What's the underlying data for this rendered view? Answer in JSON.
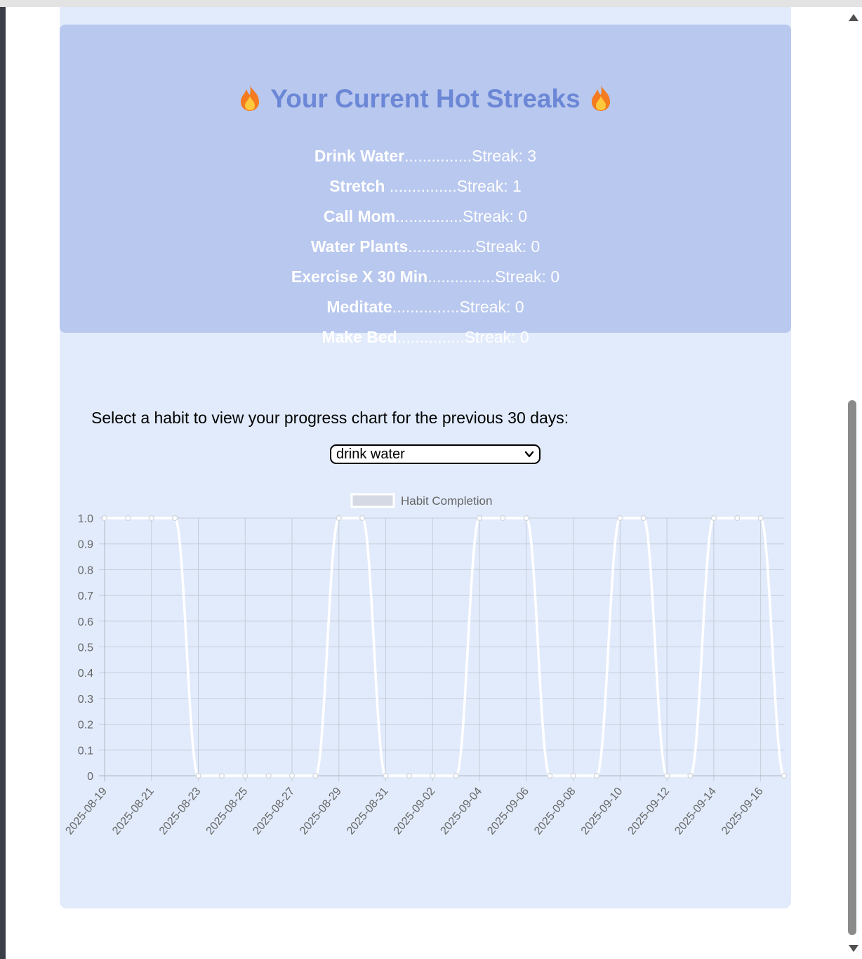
{
  "streaks": {
    "title": "Your Current Hot Streaks",
    "flame_icon": "fire-emoji",
    "items": [
      {
        "name": "Drink Water",
        "dots": "...............",
        "streak": "Streak: 3"
      },
      {
        "name": "Stretch ",
        "dots": "...............",
        "streak": "Streak: 1"
      },
      {
        "name": "Call Mom",
        "dots": "...............",
        "streak": "Streak: 0"
      },
      {
        "name": "Water Plants",
        "dots": "...............",
        "streak": "Streak: 0"
      },
      {
        "name": "Exercise X 30 Min",
        "dots": "...............",
        "streak": "Streak: 0"
      },
      {
        "name": "Meditate",
        "dots": "...............",
        "streak": "Streak: 0"
      },
      {
        "name": "Make Bed",
        "dots": "...............",
        "streak": "Streak: 0"
      }
    ]
  },
  "chart_section": {
    "prompt": "Select a habit to view your progress chart for the previous 30 days:",
    "habit_select": {
      "value": "drink water",
      "icon": "chevron-down-icon"
    }
  },
  "colors": {
    "page_bg": "#e2ebfb",
    "card_bg": "#b9c8ee",
    "title": "#6b87d6",
    "line": "#ffffff",
    "grid": "#c6ccd8"
  },
  "chart_data": {
    "type": "line",
    "legend": "Habit Completion",
    "legend_position": "top",
    "grid": true,
    "ylim": [
      0,
      1
    ],
    "yticks": [
      "1.0",
      "0.9",
      "0.8",
      "0.7",
      "0.6",
      "0.5",
      "0.4",
      "0.3",
      "0.2",
      "0.1",
      "0"
    ],
    "x": [
      "2025-08-19",
      "2025-08-20",
      "2025-08-21",
      "2025-08-22",
      "2025-08-23",
      "2025-08-24",
      "2025-08-25",
      "2025-08-26",
      "2025-08-27",
      "2025-08-28",
      "2025-08-29",
      "2025-08-30",
      "2025-08-31",
      "2025-09-01",
      "2025-09-02",
      "2025-09-03",
      "2025-09-04",
      "2025-09-05",
      "2025-09-06",
      "2025-09-07",
      "2025-09-08",
      "2025-09-09",
      "2025-09-10",
      "2025-09-11",
      "2025-09-12",
      "2025-09-13",
      "2025-09-14",
      "2025-09-15",
      "2025-09-16",
      "2025-09-17"
    ],
    "xticks": [
      "2025-08-19",
      "2025-08-21",
      "2025-08-23",
      "2025-08-25",
      "2025-08-27",
      "2025-08-29",
      "2025-08-31",
      "2025-09-02",
      "2025-09-04",
      "2025-09-06",
      "2025-09-08",
      "2025-09-10",
      "2025-09-12",
      "2025-09-14",
      "2025-09-16"
    ],
    "series": [
      {
        "name": "Habit Completion",
        "values": [
          1,
          1,
          1,
          1,
          0,
          0,
          0,
          0,
          0,
          0,
          1,
          1,
          0,
          0,
          0,
          0,
          1,
          1,
          1,
          0,
          0,
          0,
          1,
          1,
          0,
          0,
          1,
          1,
          1,
          0
        ]
      }
    ]
  }
}
